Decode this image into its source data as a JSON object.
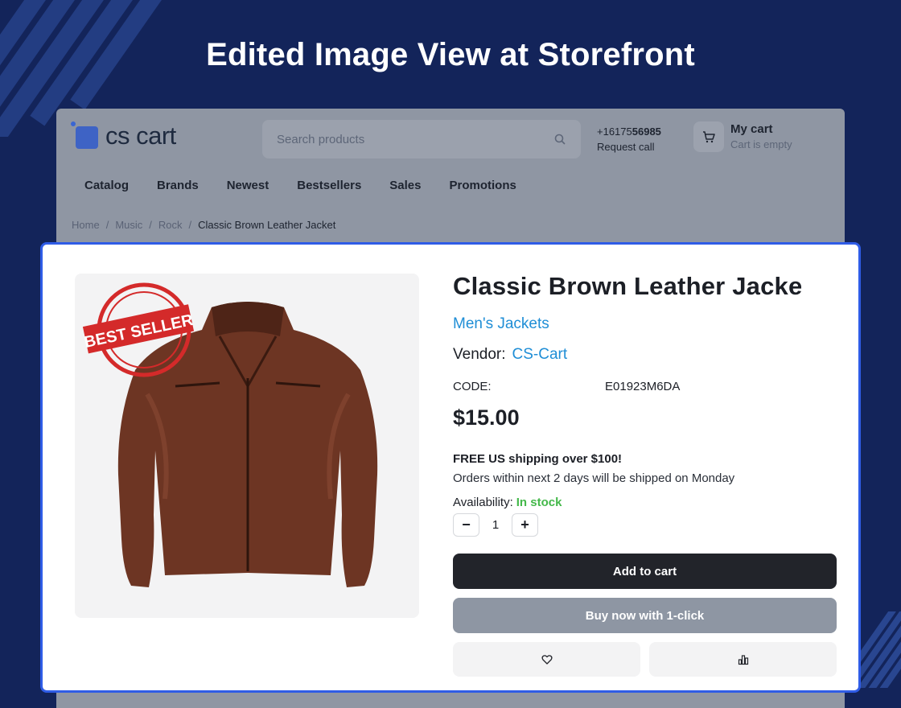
{
  "headline": "Edited Image View at Storefront",
  "store": {
    "logo_text": "cs cart",
    "search": {
      "placeholder": "Search products"
    },
    "phone": {
      "prefix": "+16175",
      "suffix": "56985",
      "request": "Request call"
    },
    "cart": {
      "title": "My cart",
      "status": "Cart is empty"
    },
    "menu": [
      "Catalog",
      "Brands",
      "Newest",
      "Bestsellers",
      "Sales",
      "Promotions"
    ],
    "breadcrumbs": [
      "Home",
      "Music",
      "Rock",
      "Classic Brown Leather Jacket"
    ]
  },
  "product": {
    "title": "Classic Brown Leather Jacket",
    "category": "Men's Jackets",
    "vendor_label": "Vendor:",
    "vendor": "CS-Cart",
    "code_label": "CODE:",
    "code": "E01923M6DA",
    "price": "$15.00",
    "shipping_headline": "FREE US shipping over $100!",
    "shipping_note": "Orders within next 2 days will be shipped on Monday",
    "availability_label": "Availability:",
    "availability": "In stock",
    "quantity": "1",
    "add_to_cart": "Add to cart",
    "buy_now": "Buy now with 1-click",
    "badge_text": "BEST SELLER",
    "icons": {
      "wishlist": "heart-icon",
      "compare": "compare-icon",
      "search": "search-icon",
      "cart": "cart-icon"
    }
  },
  "colors": {
    "accent": "#2f5ce6",
    "link": "#1f8ed6",
    "in_stock": "#44b84a",
    "background": "#13245a"
  }
}
